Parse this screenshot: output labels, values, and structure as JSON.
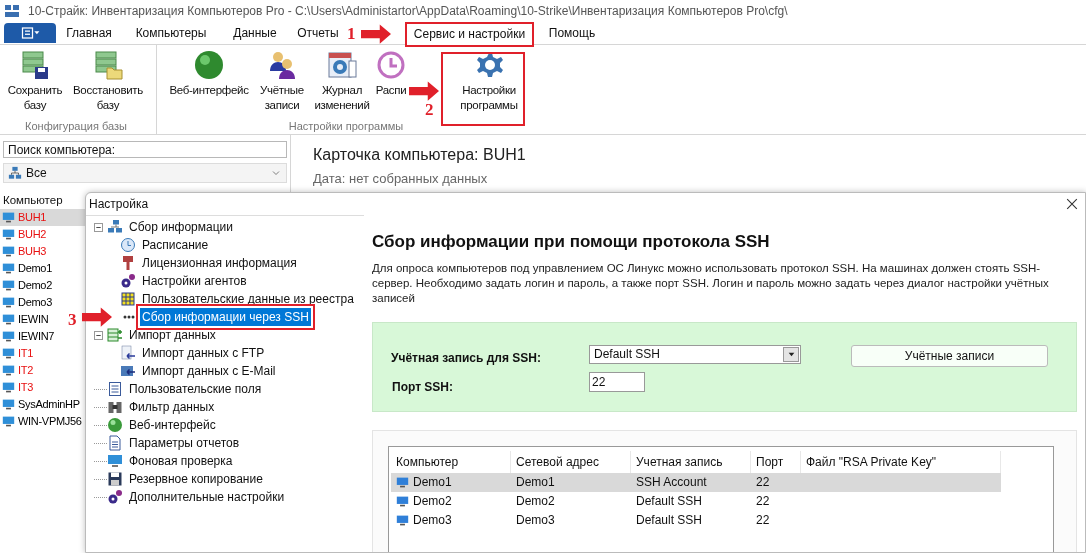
{
  "window": {
    "title": "10-Страйк: Инвентаризация Компьютеров Pro - C:\\Users\\Administartor\\AppData\\Roaming\\10-Strike\\Инвентаризация Компьютеров Pro\\cfg\\"
  },
  "ribbon": {
    "tabs": [
      {
        "label": "Главная",
        "selected": false
      },
      {
        "label": "Компьютеры",
        "selected": false
      },
      {
        "label": "Данные",
        "selected": false
      },
      {
        "label": "Отчеты",
        "selected": false
      },
      {
        "label": "Сервис и настройки",
        "selected": true
      },
      {
        "label": "Помощь",
        "selected": false
      }
    ],
    "groups": [
      {
        "label": "Конфигурация базы",
        "buttons": [
          "Сохранить\nбазу",
          "Восстановить\nбазу"
        ]
      },
      {
        "label": "Настройки программы",
        "buttons": [
          "Веб-интерфейс",
          "Учётные\nзаписи",
          "Журнал\nизменений",
          "Распи",
          "Настройки\nпрограммы"
        ]
      }
    ]
  },
  "left_panel": {
    "search": {
      "placeholder": "Поиск компьютера:"
    },
    "filter": "Все",
    "column": "Компьютер",
    "computers": [
      {
        "name": "BUH1",
        "color": "#e81010",
        "selected": true
      },
      {
        "name": "BUH2",
        "color": "#e81010",
        "selected": false
      },
      {
        "name": "BUH3",
        "color": "#e81010",
        "selected": false
      },
      {
        "name": "Demo1",
        "color": "#000000",
        "selected": false
      },
      {
        "name": "Demo2",
        "color": "#000000",
        "selected": false
      },
      {
        "name": "Demo3",
        "color": "#000000",
        "selected": false
      },
      {
        "name": "IEWIN",
        "color": "#000000",
        "selected": false
      },
      {
        "name": "IEWIN7",
        "color": "#000000",
        "selected": false
      },
      {
        "name": "IT1",
        "color": "#e81010",
        "selected": false
      },
      {
        "name": "IT2",
        "color": "#e81010",
        "selected": false
      },
      {
        "name": "IT3",
        "color": "#e81010",
        "selected": false
      },
      {
        "name": "SysAdminHP",
        "color": "#000000",
        "selected": false
      },
      {
        "name": "WIN-VPMJ56",
        "color": "#000000",
        "selected": false
      }
    ]
  },
  "card": {
    "title": "Карточка компьютера: BUH1",
    "date": "Дата: нет собранных данных"
  },
  "dialog": {
    "title": "Настройка",
    "tree": [
      {
        "label": "Сбор информации",
        "expanded": true,
        "selected": false,
        "children": [
          {
            "label": "Расписание",
            "selected": false
          },
          {
            "label": "Лицензионная информация",
            "selected": false
          },
          {
            "label": "Настройки агентов",
            "selected": false
          },
          {
            "label": "Пользовательские данные из реестра",
            "selected": false
          },
          {
            "label": "Сбор информации через SSH",
            "selected": true
          }
        ]
      },
      {
        "label": "Импорт данных",
        "expanded": true,
        "selected": false,
        "children": [
          {
            "label": "Импорт данных с FTP",
            "selected": false
          },
          {
            "label": "Импорт данных с E-Mail",
            "selected": false
          }
        ]
      },
      {
        "label": "Пользовательские поля",
        "selected": false
      },
      {
        "label": "Фильтр данных",
        "selected": false
      },
      {
        "label": "Веб-интерфейс",
        "selected": false
      },
      {
        "label": "Параметры отчетов",
        "selected": false
      },
      {
        "label": "Фоновая проверка",
        "selected": false
      },
      {
        "label": "Резервное копирование",
        "selected": false
      },
      {
        "label": "Дополнительные настройки",
        "selected": false
      }
    ],
    "heading": "Сбор информации при помощи протокола SSH",
    "description": "Для опроса компьютеров под управлением ОС Линукс можно использовать протокол SSH. На машинах должен стоять SSH-сервер. Необходимо задать логин и пароль, а также порт SSH.  Логин и пароль можно задать через диалог настройки учётных записей",
    "account_label": "Учётная запись для SSH:",
    "account_value": "Default SSH",
    "accounts_button": "Учётные записи",
    "port_label": "Порт SSH:",
    "port_value": "22",
    "table": {
      "columns": [
        "Компьютер",
        "Сетевой адрес",
        "Учетная запись",
        "Порт",
        "Файл \"RSA Private Key\""
      ],
      "rows": [
        {
          "cells": [
            "Demo1",
            "Demo1",
            "SSH Account",
            "22",
            ""
          ],
          "selected": true
        },
        {
          "cells": [
            "Demo2",
            "Demo2",
            "Default SSH",
            "22",
            ""
          ],
          "selected": false
        },
        {
          "cells": [
            "Demo3",
            "Demo3",
            "Default SSH",
            "22",
            ""
          ],
          "selected": false
        }
      ]
    }
  },
  "annotations": [
    "1",
    "2",
    "3"
  ]
}
